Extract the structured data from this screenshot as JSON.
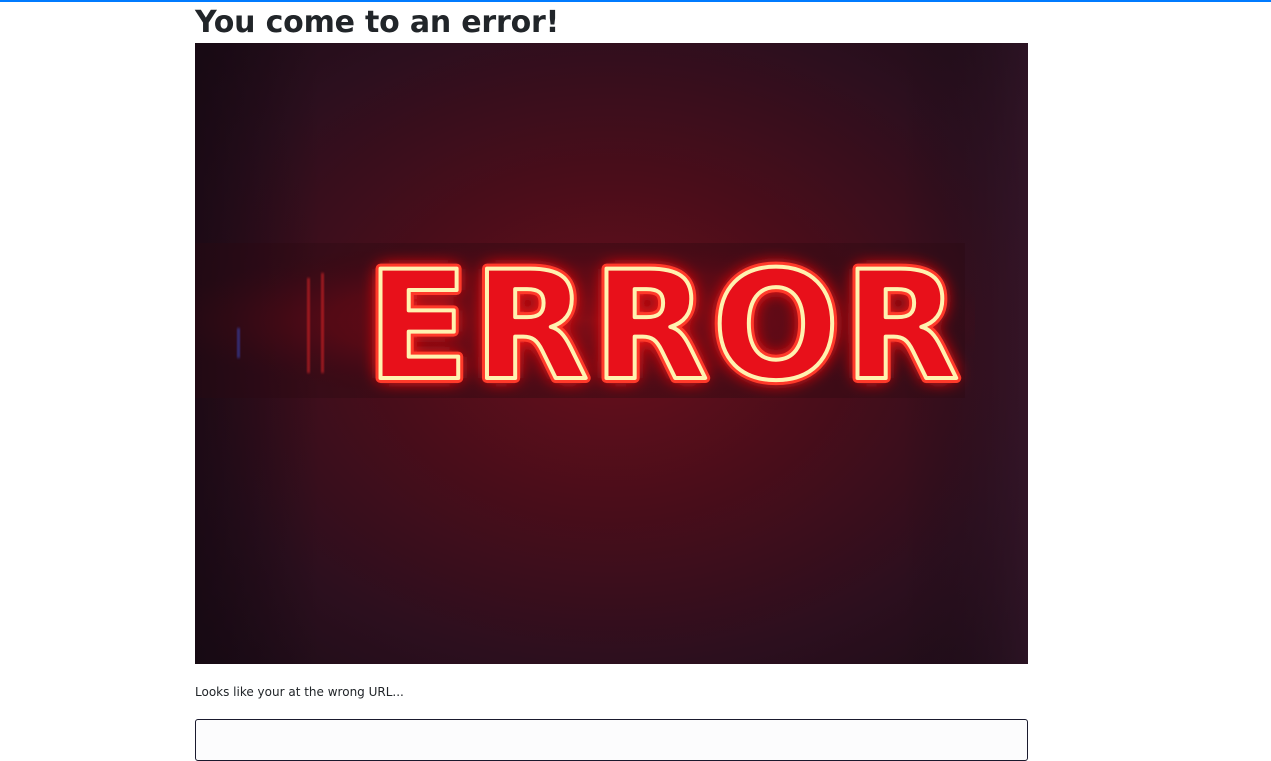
{
  "page": {
    "title": "You come to an error!",
    "description": "Looks like your at the wrong URL...",
    "accent_color": "#007bff"
  },
  "hero": {
    "sign_text": "ERROR",
    "icon": "neon-error-sign-image",
    "glow_color": "#ff1a1a",
    "tube_color": "#fff2b0",
    "background_color": "#2a0d18"
  }
}
